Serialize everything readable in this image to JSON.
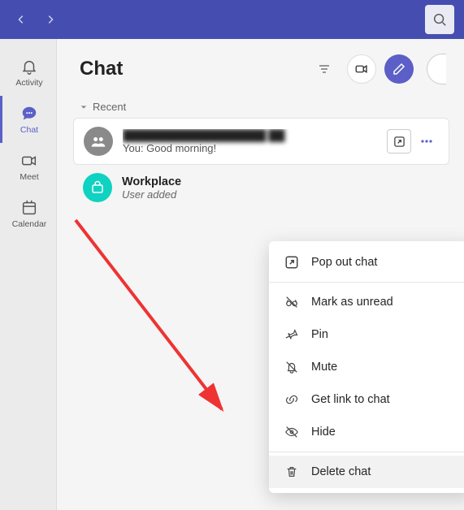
{
  "sidebar": {
    "items": [
      {
        "label": "Activity"
      },
      {
        "label": "Chat"
      },
      {
        "label": "Meet"
      },
      {
        "label": "Calendar"
      }
    ]
  },
  "header": {
    "title": "Chat"
  },
  "section": {
    "label": "Recent"
  },
  "chats": [
    {
      "title": "██████████████████ ██",
      "subtitle": "You: Good morning!"
    },
    {
      "title": "Workplace",
      "subtitle": "User added"
    }
  ],
  "menu": {
    "popout": "Pop out chat",
    "unread": "Mark as unread",
    "pin": "Pin",
    "mute": "Mute",
    "link": "Get link to chat",
    "hide": "Hide",
    "delete": "Delete chat"
  }
}
